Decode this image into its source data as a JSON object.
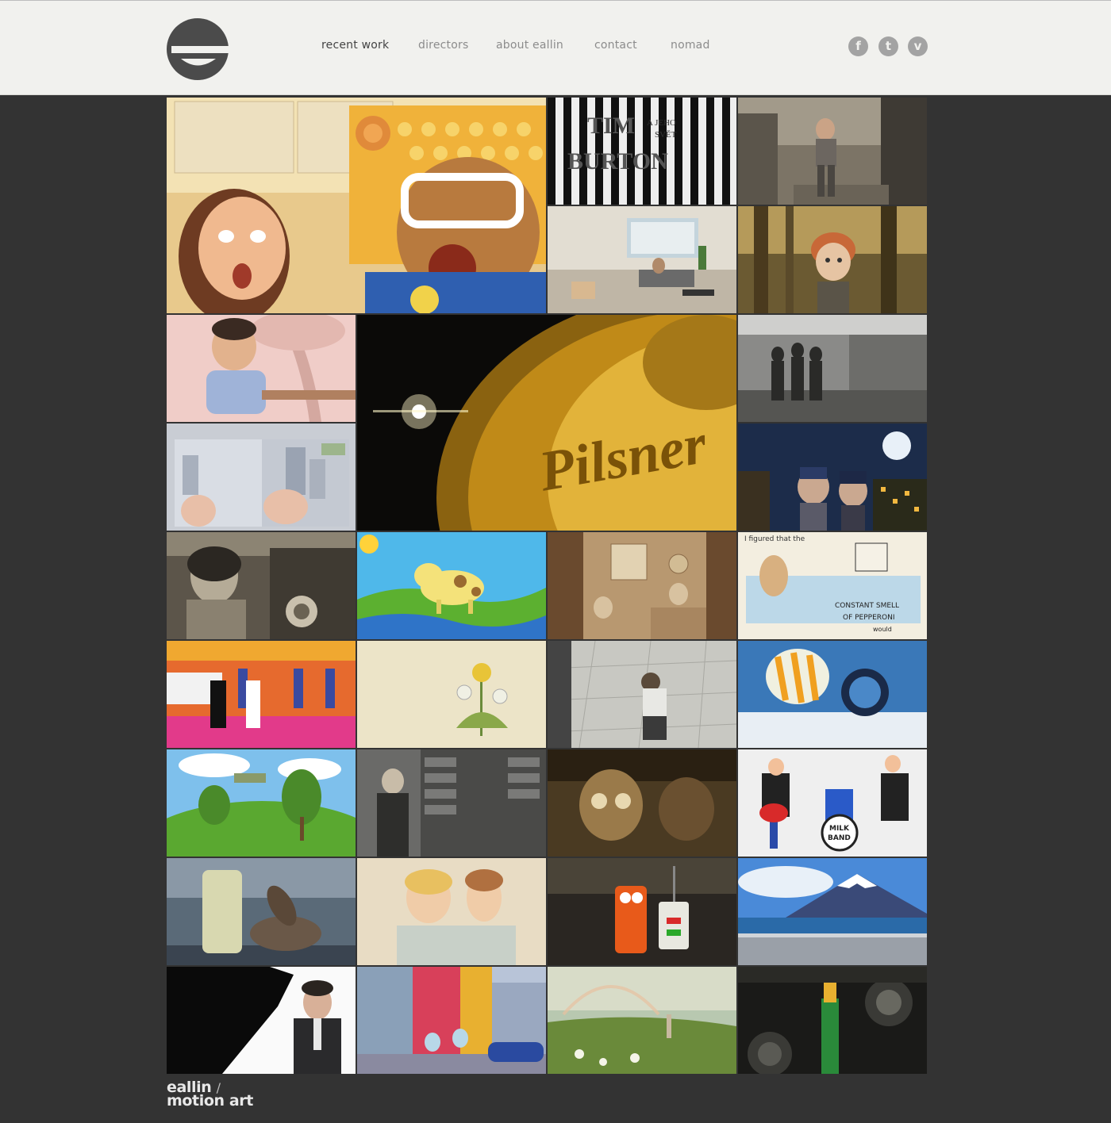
{
  "brand": {
    "logo_icon": "eallin-e-logo-icon",
    "footer_line1": "eallin",
    "footer_line2": "motion art"
  },
  "nav": {
    "items": [
      {
        "label": "recent work",
        "active": true
      },
      {
        "label": "directors",
        "active": false
      },
      {
        "label": "about eallin",
        "active": false
      },
      {
        "label": "contact",
        "active": false
      },
      {
        "label": "nomad",
        "active": false
      }
    ]
  },
  "social": [
    {
      "icon": "facebook-icon",
      "glyph": "f"
    },
    {
      "icon": "twitter-icon",
      "glyph": "t"
    },
    {
      "icon": "vimeo-icon",
      "glyph": "v"
    }
  ],
  "colors": {
    "header_bg": "#f1f1ee",
    "page_bg": "#333333",
    "nav_active": "#444444",
    "nav_inactive": "#8c8c8c",
    "social_icon": "#a3a3a3"
  },
  "thumbnail_texts": {
    "tim_burton_line1": "TIM",
    "tim_burton_line2": "BURTON",
    "tim_burton_line3": "A JEHO",
    "tim_burton_line4": "SVĚT",
    "pilsner": "Pilsner",
    "pepperoni_line1": "I figured that the",
    "pepperoni_line2": "CONSTANT SMELL",
    "pepperoni_line3": "OF PEPPERONI",
    "pepperoni_line4": "would",
    "milk_band_line1": "MILK",
    "milk_band_line2": "BAND"
  }
}
